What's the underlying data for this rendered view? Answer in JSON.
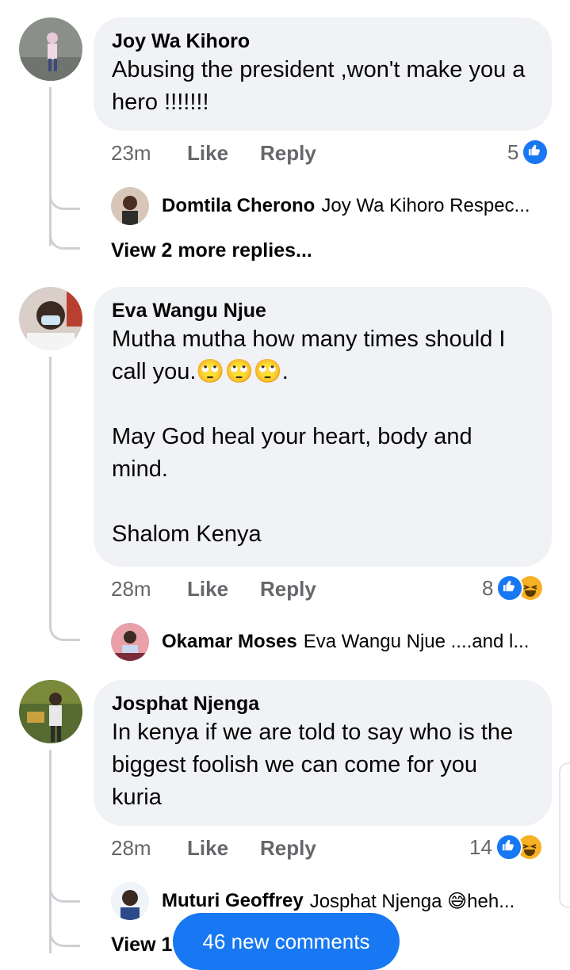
{
  "comments": [
    {
      "author": "Joy Wa Kihoro",
      "text": "Abusing the president ,won't make you a hero !!!!!!!",
      "time": "23m",
      "like_label": "Like",
      "reply_label": "Reply",
      "reaction_count": "5",
      "reactions": [
        "like-icon"
      ],
      "reply": {
        "author": "Domtila Cherono",
        "text": "Joy Wa Kihoro Respec..."
      },
      "more_replies": "View 2 more replies..."
    },
    {
      "author": "Eva Wangu Njue",
      "text": "Mutha mutha how many times should I call you.🙄🙄🙄.\n\nMay God heal your heart, body and mind.\n\nShalom Kenya",
      "time": "28m",
      "like_label": "Like",
      "reply_label": "Reply",
      "reaction_count": "8",
      "reactions": [
        "like-icon",
        "haha-icon"
      ],
      "reply": {
        "author": "Okamar Moses",
        "text": "Eva Wangu Njue ....and l..."
      }
    },
    {
      "author": "Josphat Njenga",
      "text": "In kenya if we are told to say who is the biggest foolish we can come for you kuria",
      "time": "28m",
      "like_label": "Like",
      "reply_label": "Reply",
      "reaction_count": "14",
      "reactions": [
        "like-icon",
        "haha-icon"
      ],
      "reply": {
        "author": "Muturi Geoffrey",
        "text": "Josphat Njenga 😅heh..."
      },
      "more_replies": "View 1"
    }
  ],
  "new_comments_button": "46 new comments",
  "colors": {
    "accent": "#1877f2",
    "bubble": "#f0f2f5",
    "meta": "#65676b",
    "haha": "#f7b125"
  }
}
